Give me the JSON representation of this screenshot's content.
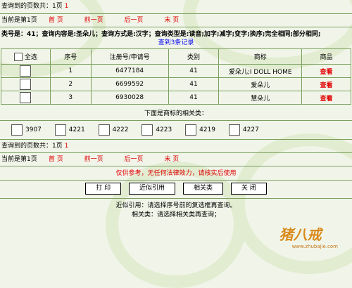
{
  "pager_top": {
    "total_label": "查询到的页数共：1页",
    "total_value": "1",
    "current_label": "当前是第1页",
    "links": [
      "首 页",
      "前一页",
      "后一页",
      "末 页"
    ]
  },
  "summary": {
    "text": "类号是：41；查询内容是:圣朵儿；查询方式是:汉字；查询类型是:读音;加字;减字;变字;换序;完全相同;部分相同;",
    "count_link": "查到3条记录"
  },
  "table": {
    "headers": [
      "全选",
      "序号",
      "注册号/申请号",
      "类别",
      "商标",
      "商品"
    ],
    "rows": [
      {
        "seq": "1",
        "reg_no": "6477184",
        "class": "41",
        "mark": "爱朵儿;I DOLL HOME",
        "action": "查看"
      },
      {
        "seq": "2",
        "reg_no": "6699592",
        "class": "41",
        "mark": "爱朵儿",
        "action": "查看"
      },
      {
        "seq": "3",
        "reg_no": "6930028",
        "class": "41",
        "mark": "慧朵儿",
        "action": "查看"
      }
    ]
  },
  "related": {
    "heading": "下面是商标的相关类：",
    "classes": [
      "3907",
      "4221",
      "4222",
      "4223",
      "4219",
      "4227"
    ]
  },
  "pager_bottom": {
    "total_label": "查询到的页数共：1页",
    "total_value": "1",
    "current_label": "当前是第1页",
    "links": [
      "首 页",
      "前一页",
      "后一页",
      "末 页"
    ]
  },
  "notice": "仅供参考，无任何法律效力，请核实后使用",
  "buttons": {
    "print": "打 印",
    "similar": "近似引用",
    "related": "相关类",
    "close": "关 闭"
  },
  "help": {
    "line1": "近似引用：请选择序号前的复选框再查询。",
    "line2": "相关类：请选择相关类再查询；"
  },
  "logo": {
    "text": "猪八戒",
    "site": "www.zhubajie.com"
  },
  "colors": {
    "link_red": "#e00000",
    "link_blue": "#0000ee",
    "border": "#7aa05f",
    "background": "#f1f5e9"
  }
}
